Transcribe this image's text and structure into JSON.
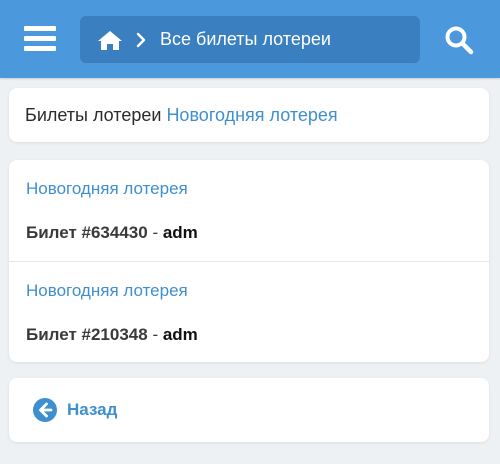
{
  "header": {
    "breadcrumb_text": "Все билеты лотереи",
    "menu_icon": "hamburger-menu-icon",
    "home_icon": "home-icon",
    "search_icon": "search-icon",
    "color": "#4b98dc"
  },
  "title_card": {
    "prefix": "Билеты лотереи",
    "lottery_link": "Новогодняя лотерея"
  },
  "tickets": [
    {
      "lottery": "Новогодняя лотерея",
      "ticket": "Билет #634430",
      "separator": " - ",
      "user": "adm"
    },
    {
      "lottery": "Новогодняя лотерея",
      "ticket": "Билет #210348",
      "separator": " - ",
      "user": "adm"
    }
  ],
  "back": {
    "label": "Назад",
    "icon": "arrow-left-circle-icon"
  },
  "colors": {
    "accent": "#3f8fcf",
    "background": "#eef1f4"
  }
}
